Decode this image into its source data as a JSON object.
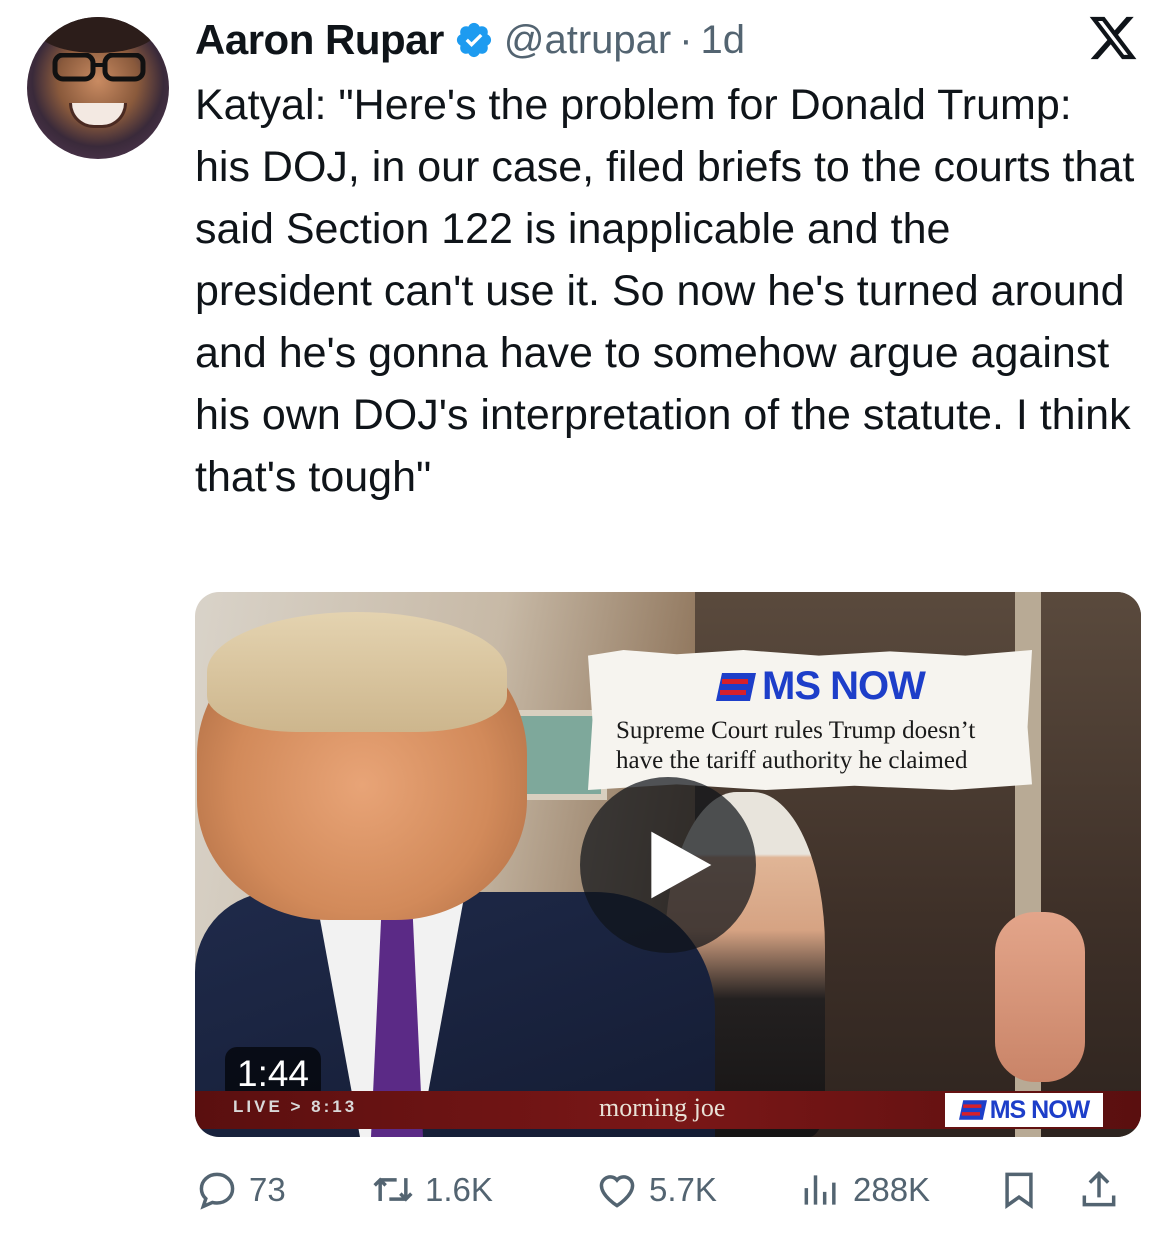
{
  "author": {
    "name": "Aaron Rupar",
    "handle": "@atrupar",
    "separator": "·",
    "age": "1d",
    "verified": true
  },
  "platform_icon": "x-logo-icon",
  "tweet": {
    "text": "Katyal: \"Here's the problem for Donald Trump: his DOJ, in our case, filed briefs to the courts that said Section 122 is inapplicable and the president can't use it. So now he's turned around and he's gonna have to somehow argue against his own DOJ's interpretation of the statute. I think that's tough\""
  },
  "media": {
    "clipping_brand": "MS NOW",
    "clipping_headline": "Supreme Court rules Trump doesn’t have the tariff authority he claimed",
    "duration": "1:44",
    "live_label": "LIVE > 8:13",
    "program": "morning joe",
    "bug_brand": "MS NOW"
  },
  "actions": {
    "replies": "73",
    "reposts": "1.6K",
    "likes": "5.7K",
    "views": "288K"
  },
  "colors": {
    "text": "#0f1419",
    "secondary": "#536471",
    "verified": "#1d9bf0",
    "brand_blue": "#1d3ec9",
    "brand_red": "#d6202a"
  }
}
